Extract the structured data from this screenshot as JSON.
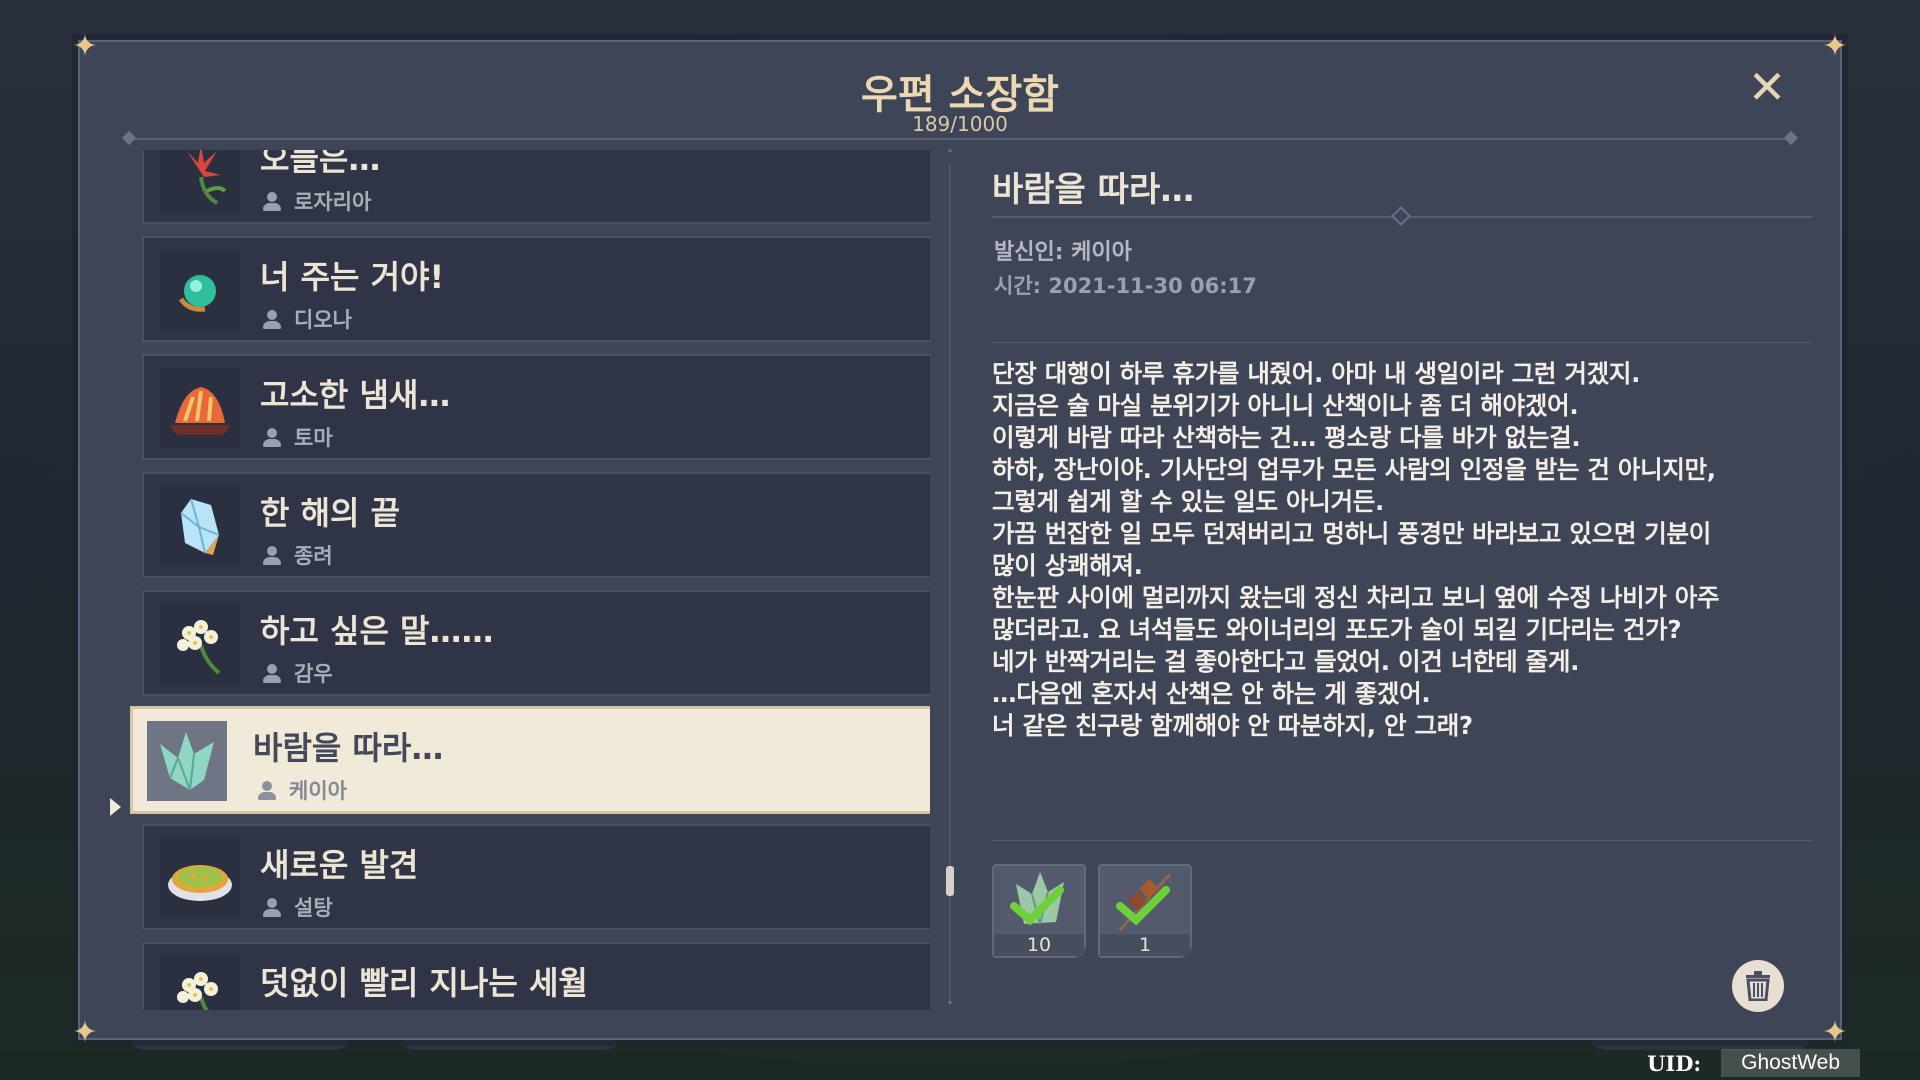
{
  "window": {
    "title": "우편 소장함",
    "count": "189/1000"
  },
  "mail_list": [
    {
      "title": "오늘은…",
      "sender": "로자리아",
      "icon": "red-lily-flower-icon"
    },
    {
      "title": "너 주는 거야!",
      "sender": "디오나",
      "icon": "glowing-orb-icon"
    },
    {
      "title": "고소한 냄새…",
      "sender": "토마",
      "icon": "fried-fish-dish-icon"
    },
    {
      "title": "한 해의 끝",
      "sender": "종려",
      "icon": "ice-crystal-icon"
    },
    {
      "title": "하고 싶은 말……",
      "sender": "감우",
      "icon": "white-flower-icon"
    },
    {
      "title": "바람을 따라…",
      "sender": "케이아",
      "icon": "crystal-fragment-icon",
      "selected": true
    },
    {
      "title": "새로운 발견",
      "sender": "설탕",
      "icon": "pie-dish-icon"
    },
    {
      "title": "덧없이 빨리 지나는 세월",
      "sender": "",
      "icon": "white-flower-icon"
    }
  ],
  "detail": {
    "title": "바람을 따라…",
    "sender_line": "발신인: 케이아",
    "time_line": "시간: 2021-11-30 06:17",
    "body": "단장 대행이 하루 휴가를 내줬어. 아마 내 생일이라 그런 거겠지.\n지금은 술 마실 분위기가 아니니 산책이나 좀 더 해야겠어.\n이렇게 바람 따라 산책하는 건… 평소랑 다를 바가 없는걸.\n하하, 장난이야. 기사단의 업무가 모든 사람의 인정을 받는 건 아니지만,\n그렇게 쉽게 할 수 있는 일도 아니거든.\n가끔 번잡한 일 모두 던져버리고 멍하니 풍경만 바라보고 있으면 기분이\n많이 상쾌해져.\n한눈판 사이에 멀리까지 왔는데 정신 차리고 보니 옆에 수정 나비가 아주\n많더라고. 요 녀석들도 와이너리의 포도가 술이 되길 기다리는 건가?\n네가 반짝거리는 걸 좋아한다고 들었어. 이건 너한테 줄게.\n…다음엔 혼자서 산책은 안 하는 게 좋겠어.\n너 같은 친구랑 함께해야 안 따분하지, 안 그래?",
    "attachments": [
      {
        "count": "10",
        "icon": "crystal-chunk-icon",
        "claimed": true
      },
      {
        "count": "1",
        "icon": "skewer-dish-icon",
        "claimed": true
      }
    ]
  },
  "uid": {
    "label": "UID:",
    "value": "GhostWeb"
  },
  "colors": {
    "panel": "#3e4557",
    "item": "#2f3546",
    "selected": "#f2ead9",
    "title_gold": "#ecd9b3",
    "check_green": "#6fd13a"
  }
}
